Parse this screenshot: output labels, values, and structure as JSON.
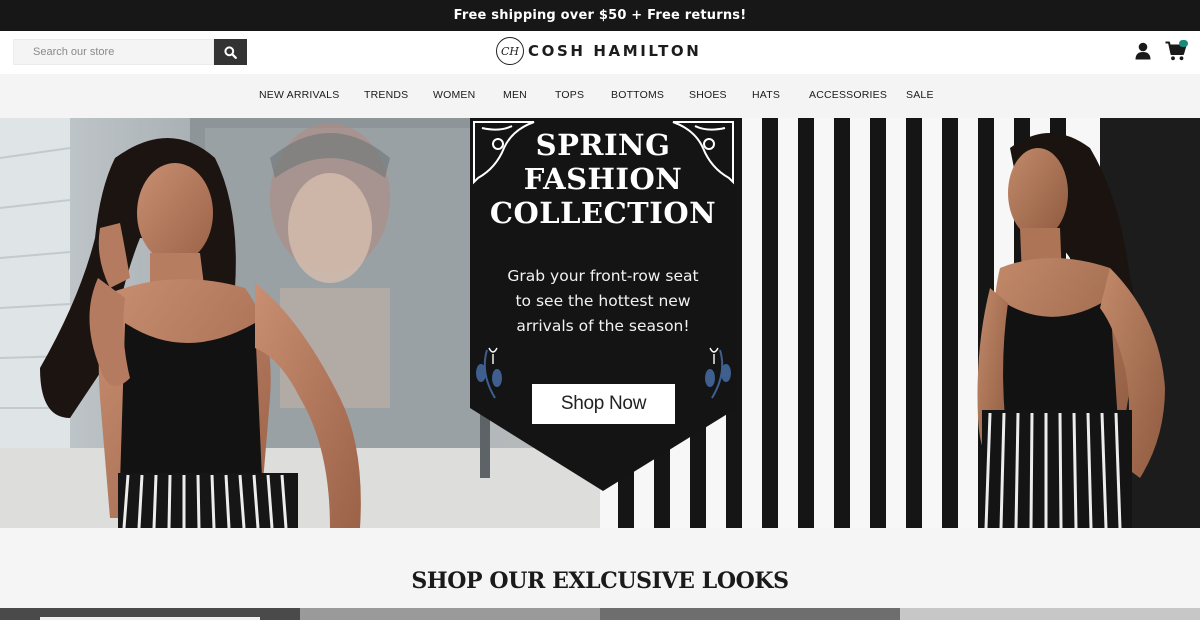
{
  "promo": {
    "text": "Free shipping over $50 + Free returns!"
  },
  "header": {
    "search_placeholder": "Search our store",
    "logo_monogram": "CH",
    "logo_text": "COSH HAMILTON",
    "icons": {
      "search": "search-icon",
      "account": "user-icon",
      "cart": "cart-icon"
    },
    "accent_color": "#1b8a7a"
  },
  "nav": {
    "items": [
      "NEW ARRIVALS",
      "TRENDS",
      "WOMEN",
      "MEN",
      "TOPS",
      "BOTTOMS",
      "SHOES",
      "HATS",
      "ACCESSORIES",
      "SALE"
    ]
  },
  "hero": {
    "title_lines": [
      "SPRING",
      "FASHION",
      "COLLECTION"
    ],
    "subtitle_lines": [
      "Grab your front-row seat",
      "to see the hottest new",
      "arrivals of the season!"
    ],
    "cta_label": "Shop Now"
  },
  "section": {
    "title": "SHOP OUR EXLCUSIVE LOOKS"
  }
}
